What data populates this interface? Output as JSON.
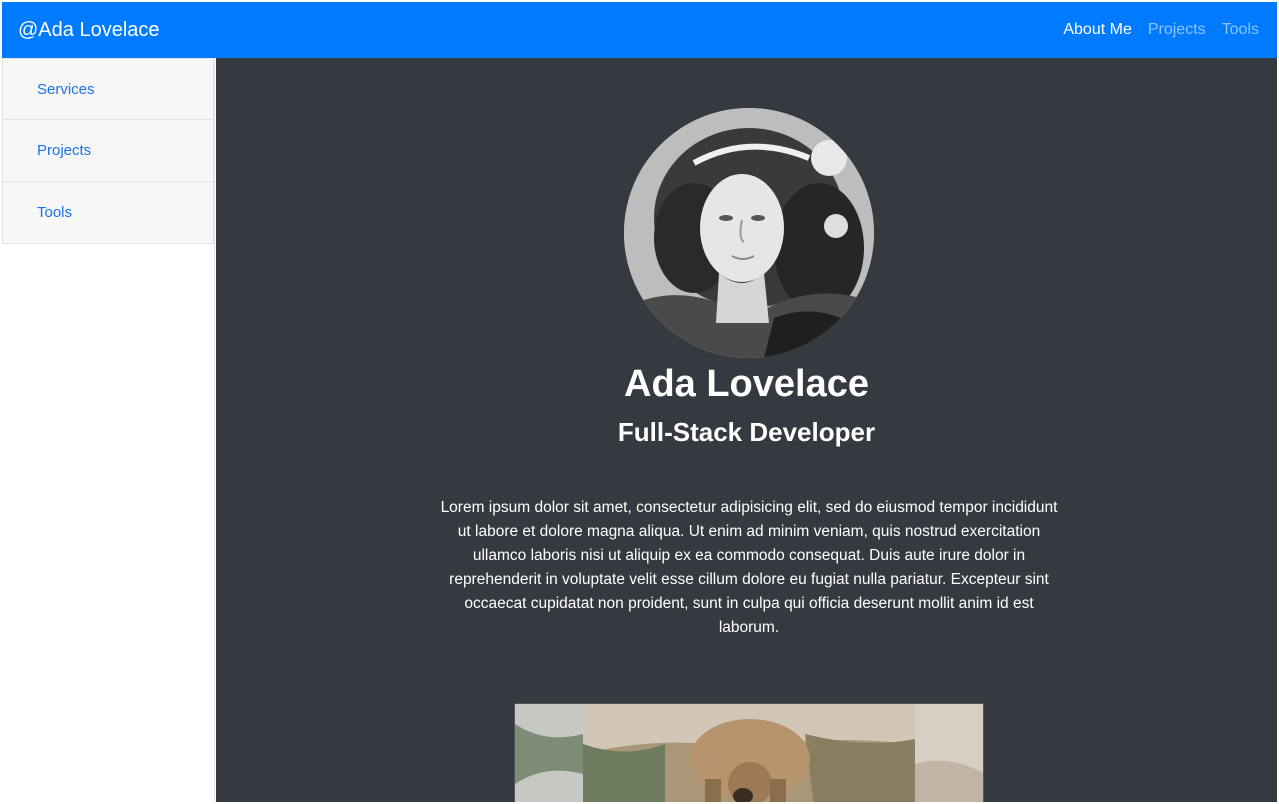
{
  "navbar": {
    "brand": "@Ada Lovelace",
    "links": [
      {
        "label": "About Me",
        "active": true
      },
      {
        "label": "Projects",
        "active": false
      },
      {
        "label": "Tools",
        "active": false
      }
    ]
  },
  "sidebar": {
    "items": [
      {
        "label": "Services"
      },
      {
        "label": "Projects"
      },
      {
        "label": "Tools"
      }
    ]
  },
  "profile": {
    "name": "Ada Lovelace",
    "role": "Full-Stack Developer",
    "bio": "Lorem ipsum dolor sit amet, consectetur adipisicing elit, sed do eiusmod tempor incididunt ut labore et dolore magna aliqua. Ut enim ad minim veniam, quis nostrud exercitation ullamco laboris nisi ut aliquip ex ea commodo consequat. Duis aute irure dolor in reprehenderit in voluptate velit esse cillum dolore eu fugiat nulla pariatur. Excepteur sint occaecat cupidatat non proident, sunt in culpa qui officia deserunt mollit anim id est laborum."
  },
  "colors": {
    "navbar": "#007bff",
    "main_background": "#343a40",
    "sidebar_link": "#1a73e8"
  }
}
